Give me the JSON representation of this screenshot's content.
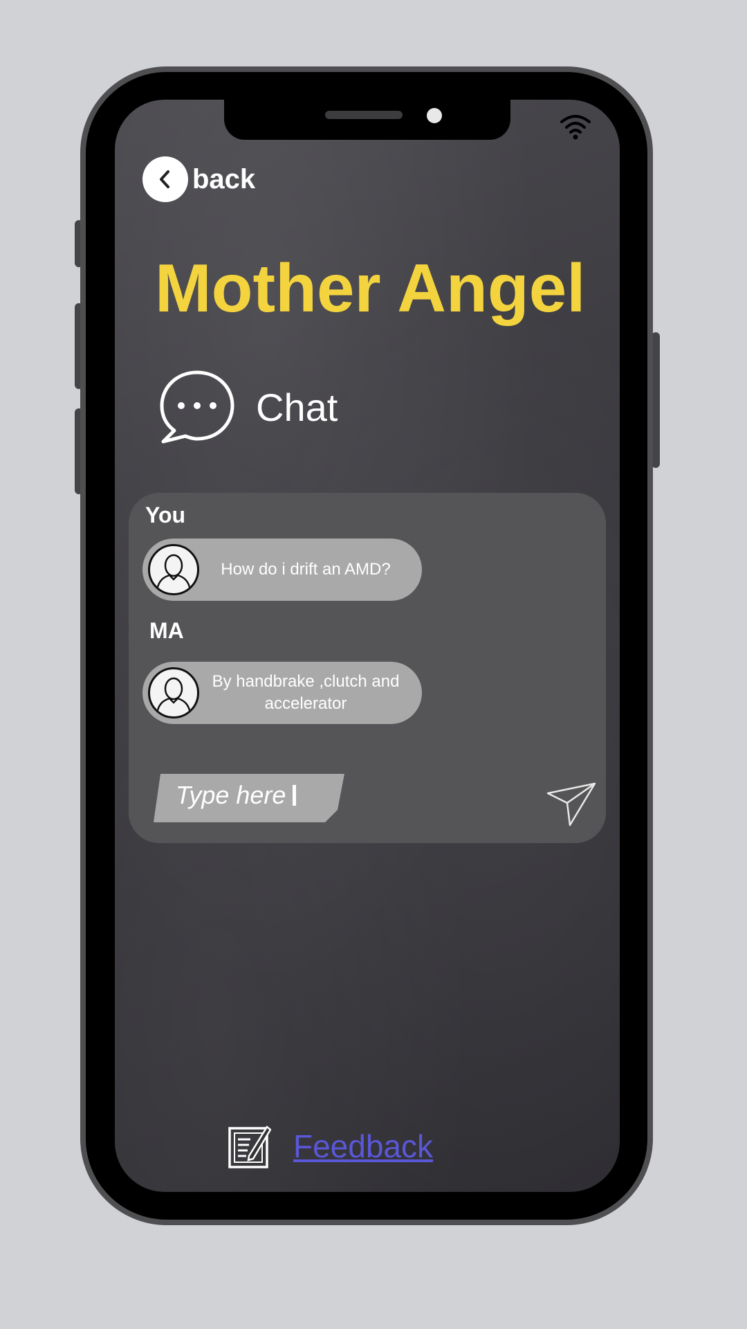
{
  "app": {
    "title": "Mother Angel"
  },
  "nav": {
    "back_label": "back",
    "back_icon": "chevron-left-icon"
  },
  "chat": {
    "label": "Chat",
    "icon": "chat-bubble-icon",
    "messages": [
      {
        "sender": "You",
        "text": "How do i drift an AMD?"
      },
      {
        "sender": "MA",
        "text": "By handbrake ,clutch and accelerator"
      }
    ],
    "input_placeholder": "Type here"
  },
  "footer": {
    "feedback_label": "Feedback",
    "feedback_icon": "note-edit-icon"
  },
  "colors": {
    "title": "#f4d43e",
    "link": "#5a57d8",
    "panel": "#555557",
    "bubble": "#a9a9a9"
  }
}
